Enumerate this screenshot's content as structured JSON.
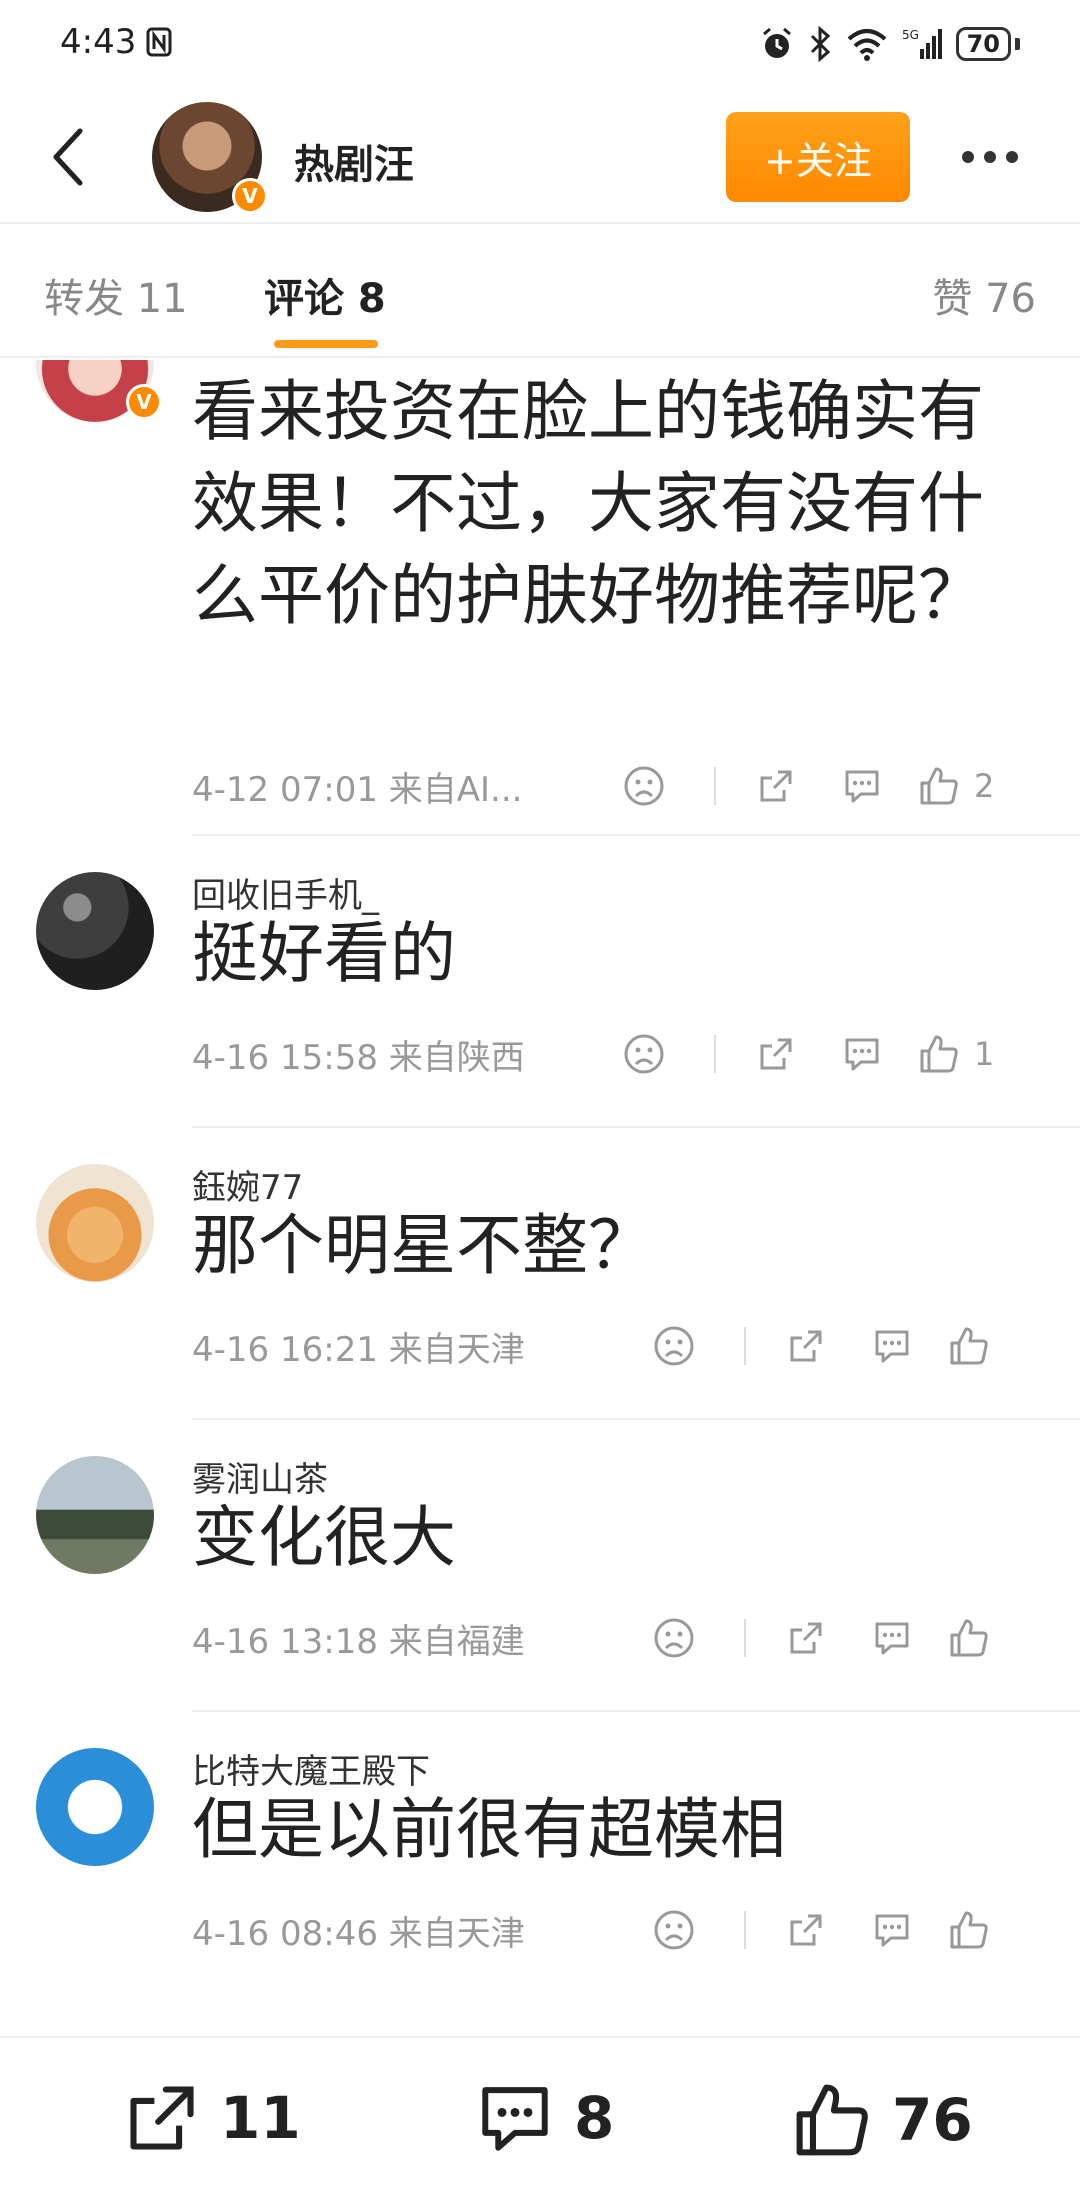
{
  "status_bar": {
    "time": "4:43",
    "battery": "70"
  },
  "header": {
    "name": "热剧汪",
    "follow_label": "+关注"
  },
  "tabs": {
    "repost": "转发 11",
    "comment": "评论 8",
    "like": "赞 76"
  },
  "comments": [
    {
      "name": "",
      "text": "看来投资在脸上的钱确实有效果！不过，大家有没有什么平价的护肤好物推荐呢？",
      "meta": "4-12 07:01  来自AI...",
      "likes": "2"
    },
    {
      "name": "回收旧手机_",
      "text": "挺好看的",
      "meta": "4-16 15:58  来自陕西",
      "likes": "1"
    },
    {
      "name": "鈺婉77",
      "text": "那个明星不整？",
      "meta": "4-16 16:21  来自天津",
      "likes": ""
    },
    {
      "name": "雾润山茶",
      "text": "变化很大",
      "meta": "4-16 13:18  来自福建",
      "likes": ""
    },
    {
      "name": "比特大魔王殿下",
      "text": "但是以前很有超模相",
      "meta": "4-16 08:46  来自天津",
      "likes": ""
    }
  ],
  "bottom_bar": {
    "reposts": "11",
    "comments": "8",
    "likes": "76"
  },
  "colors": {
    "accent": "#ff8800",
    "verified": "#ff8a00",
    "muted": "#999999"
  }
}
